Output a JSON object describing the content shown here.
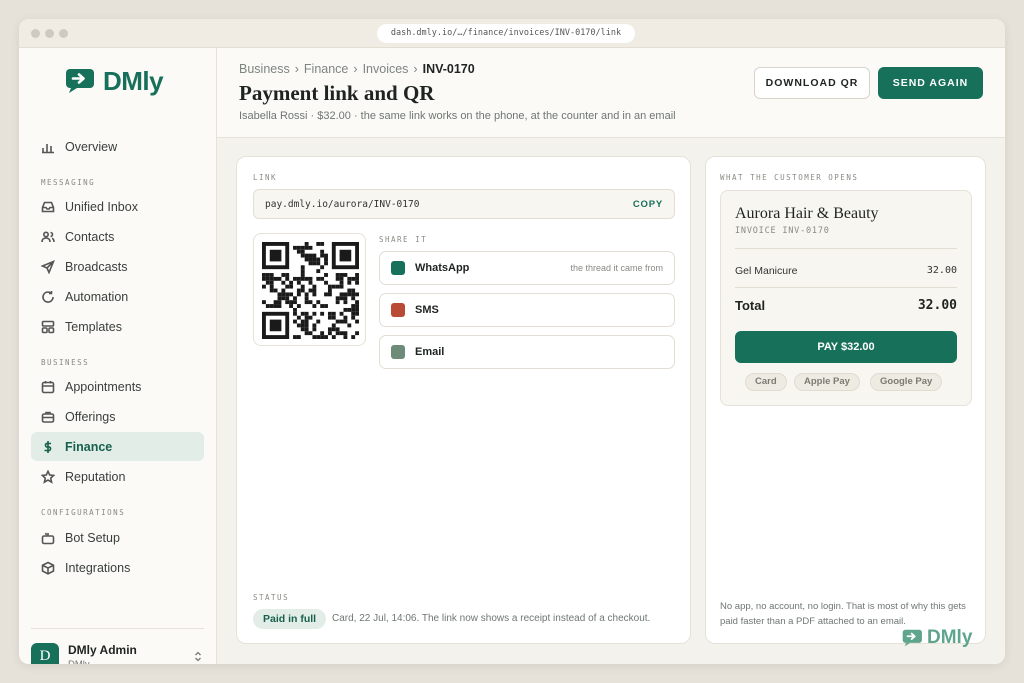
{
  "browser": {
    "url": "dash.dmly.io/…/finance/invoices/INV-0170/link"
  },
  "brand": {
    "name": "DMly",
    "color": "#17705a"
  },
  "sidebar": {
    "top_items": [
      {
        "label": "Overview",
        "icon": "bar-chart-icon"
      }
    ],
    "sections": [
      {
        "title": "MESSAGING",
        "items": [
          {
            "label": "Unified Inbox",
            "icon": "inbox-icon"
          },
          {
            "label": "Contacts",
            "icon": "users-icon"
          },
          {
            "label": "Broadcasts",
            "icon": "send-icon"
          },
          {
            "label": "Automation",
            "icon": "refresh-icon"
          },
          {
            "label": "Templates",
            "icon": "layout-icon"
          }
        ]
      },
      {
        "title": "BUSINESS",
        "items": [
          {
            "label": "Appointments",
            "icon": "calendar-icon"
          },
          {
            "label": "Offerings",
            "icon": "briefcase-icon"
          },
          {
            "label": "Finance",
            "icon": "dollar-icon",
            "active": true
          },
          {
            "label": "Reputation",
            "icon": "star-icon"
          }
        ]
      },
      {
        "title": "CONFIGURATIONS",
        "items": [
          {
            "label": "Bot Setup",
            "icon": "bot-icon"
          },
          {
            "label": "Integrations",
            "icon": "cube-icon"
          }
        ]
      }
    ],
    "user": {
      "initial": "D",
      "name": "DMly Admin",
      "role": "DMly"
    }
  },
  "header": {
    "breadcrumb": [
      "Business",
      "Finance",
      "Invoices"
    ],
    "breadcrumb_sep": "›",
    "current": "INV-0170",
    "title": "Payment link and QR",
    "subtitle": "Isabella Rossi · $32.00 · the same link works on the phone, at the counter and in an email",
    "download_label": "DOWNLOAD QR",
    "send_label": "SEND AGAIN"
  },
  "link_card": {
    "link_label": "LINK",
    "url": "pay.dmly.io/aurora/INV-0170",
    "copy_label": "COPY",
    "share_label": "SHARE IT",
    "channels": [
      {
        "name": "WhatsApp",
        "note": "the thread it came from",
        "color": "#17705a"
      },
      {
        "name": "SMS",
        "note": "",
        "color": "#b84a36"
      },
      {
        "name": "Email",
        "note": "",
        "color": "#6e8a78"
      }
    ],
    "status_label": "STATUS",
    "status_badge": "Paid in full",
    "status_text": "Card, 22 Jul, 14:06. The link now shows a receipt instead of a checkout."
  },
  "preview_card": {
    "label": "WHAT THE CUSTOMER OPENS",
    "business": "Aurora Hair & Beauty",
    "invoice": "INVOICE INV-0170",
    "line_item": {
      "name": "Gel Manicure",
      "amount": "32.00"
    },
    "total_label": "Total",
    "total_amount": "32.00",
    "pay_label": "PAY $32.00",
    "methods": [
      "Card",
      "Apple Pay",
      "Google Pay"
    ],
    "note": "No app, no account, no login. That is most of why this gets paid faster than a PDF attached to an email.",
    "watermark": "DMly"
  }
}
